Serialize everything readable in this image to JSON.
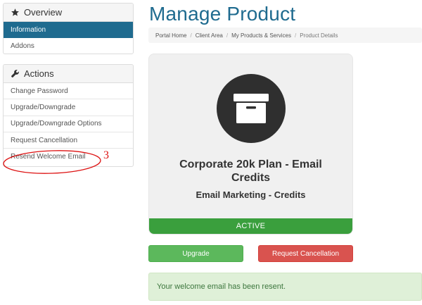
{
  "sidebar": {
    "overview": {
      "title": "Overview",
      "icon": "star-icon",
      "items": [
        {
          "label": "Information",
          "active": true
        },
        {
          "label": "Addons",
          "active": false
        }
      ]
    },
    "actions": {
      "title": "Actions",
      "icon": "wrench-icon",
      "items": [
        {
          "label": "Change Password"
        },
        {
          "label": "Upgrade/Downgrade"
        },
        {
          "label": "Upgrade/Downgrade Options"
        },
        {
          "label": "Request Cancellation"
        },
        {
          "label": "Resend Welcome Email"
        }
      ]
    }
  },
  "annotation": {
    "label": "3",
    "color": "#dd1111"
  },
  "main": {
    "title": "Manage Product",
    "breadcrumb": [
      "Portal Home",
      "Client Area",
      "My Products & Services",
      "Product Details"
    ],
    "product": {
      "icon": "archive-box-icon",
      "name": "Corporate 20k Plan - Email Credits",
      "group": "Email Marketing - Credits",
      "status": "ACTIVE"
    },
    "buttons": {
      "upgrade": "Upgrade",
      "request_cancellation": "Request Cancellation"
    },
    "alert": "Your welcome email has been resent."
  },
  "colors": {
    "brand": "#1f6b8f",
    "status_active": "#3a9f3d",
    "upgrade_button": "#5cb85c",
    "cancel_button": "#d9534f",
    "alert_bg": "#dff0d8",
    "alert_text": "#3c763d"
  }
}
